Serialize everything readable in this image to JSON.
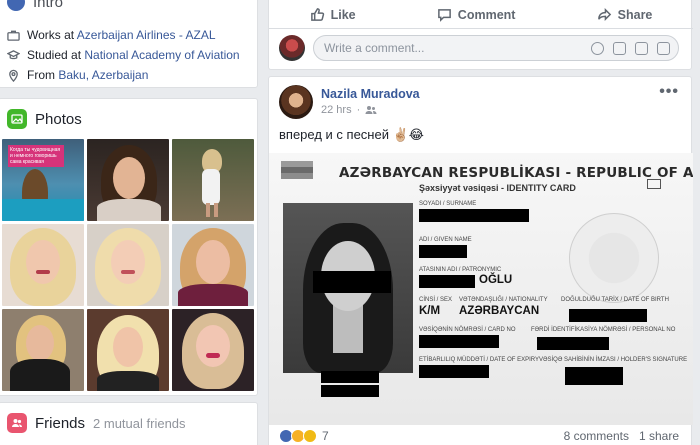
{
  "intro": {
    "title": "Intro",
    "work_prefix": "Works at ",
    "work_link": "Azerbaijan Airlines - AZAL",
    "study_prefix": "Studied at ",
    "study_link": "National Academy of Aviation",
    "from_prefix": "From ",
    "from_link": "Baku, Azerbaijan"
  },
  "photos": {
    "title": "Photos",
    "first_photo_caption": "Когда ты чудовищная и немного говоришь сама красивая"
  },
  "friends": {
    "title": "Friends",
    "mutual": "2 mutual friends"
  },
  "actions": {
    "like": "Like",
    "comment": "Comment",
    "share": "Share"
  },
  "comment_box": {
    "placeholder": "Write a comment..."
  },
  "post": {
    "author": "Nazila Muradova",
    "time": "22 hrs",
    "text": "вперед и с песней ✌🏼😂",
    "reaction_count": "7",
    "comments": "8 comments",
    "shares": "1 share"
  },
  "id_card": {
    "title": "AZƏRBAYCAN RESPUBLİKASI - REPUBLIC OF AZERBAIJAN",
    "subtitle": "Şəxsiyyət vəsiqəsi - IDENTITY CARD",
    "surname_label": "SOYADI / SURNAME",
    "given_label": "ADI / GIVEN NAME",
    "patronymic_label": "ATASININ ADI / PATRONYMIC",
    "patronymic_value": "OĞLU",
    "sex_label": "CİNSİ / SEX",
    "sex_value": "K/M",
    "nationality_label": "VƏTƏNDAŞLIĞI / NATIONALITY",
    "nationality_value": "AZƏRBAYCAN",
    "dob_label": "DOĞULDUĞU TARİX / DATE OF BIRTH",
    "card_no_label": "VƏSİQƏNİN NÖMRƏSİ / CARD NO",
    "personal_no_label": "FƏRDİ İDENTİFİKASİYA NÖMRƏSİ / PERSONAL NO",
    "expiry_label": "ETİBARLILIQ MÜDDƏTİ / DATE OF EXPIRY",
    "signature_label": "VƏSİQƏ SAHİBİNİN İMZASI / HOLDER'S SIGNATURE"
  },
  "colors": {
    "link": "#385898",
    "background": "#e9ebee",
    "photos_icon": "#42b72a",
    "friends_icon": "#e9556f"
  }
}
